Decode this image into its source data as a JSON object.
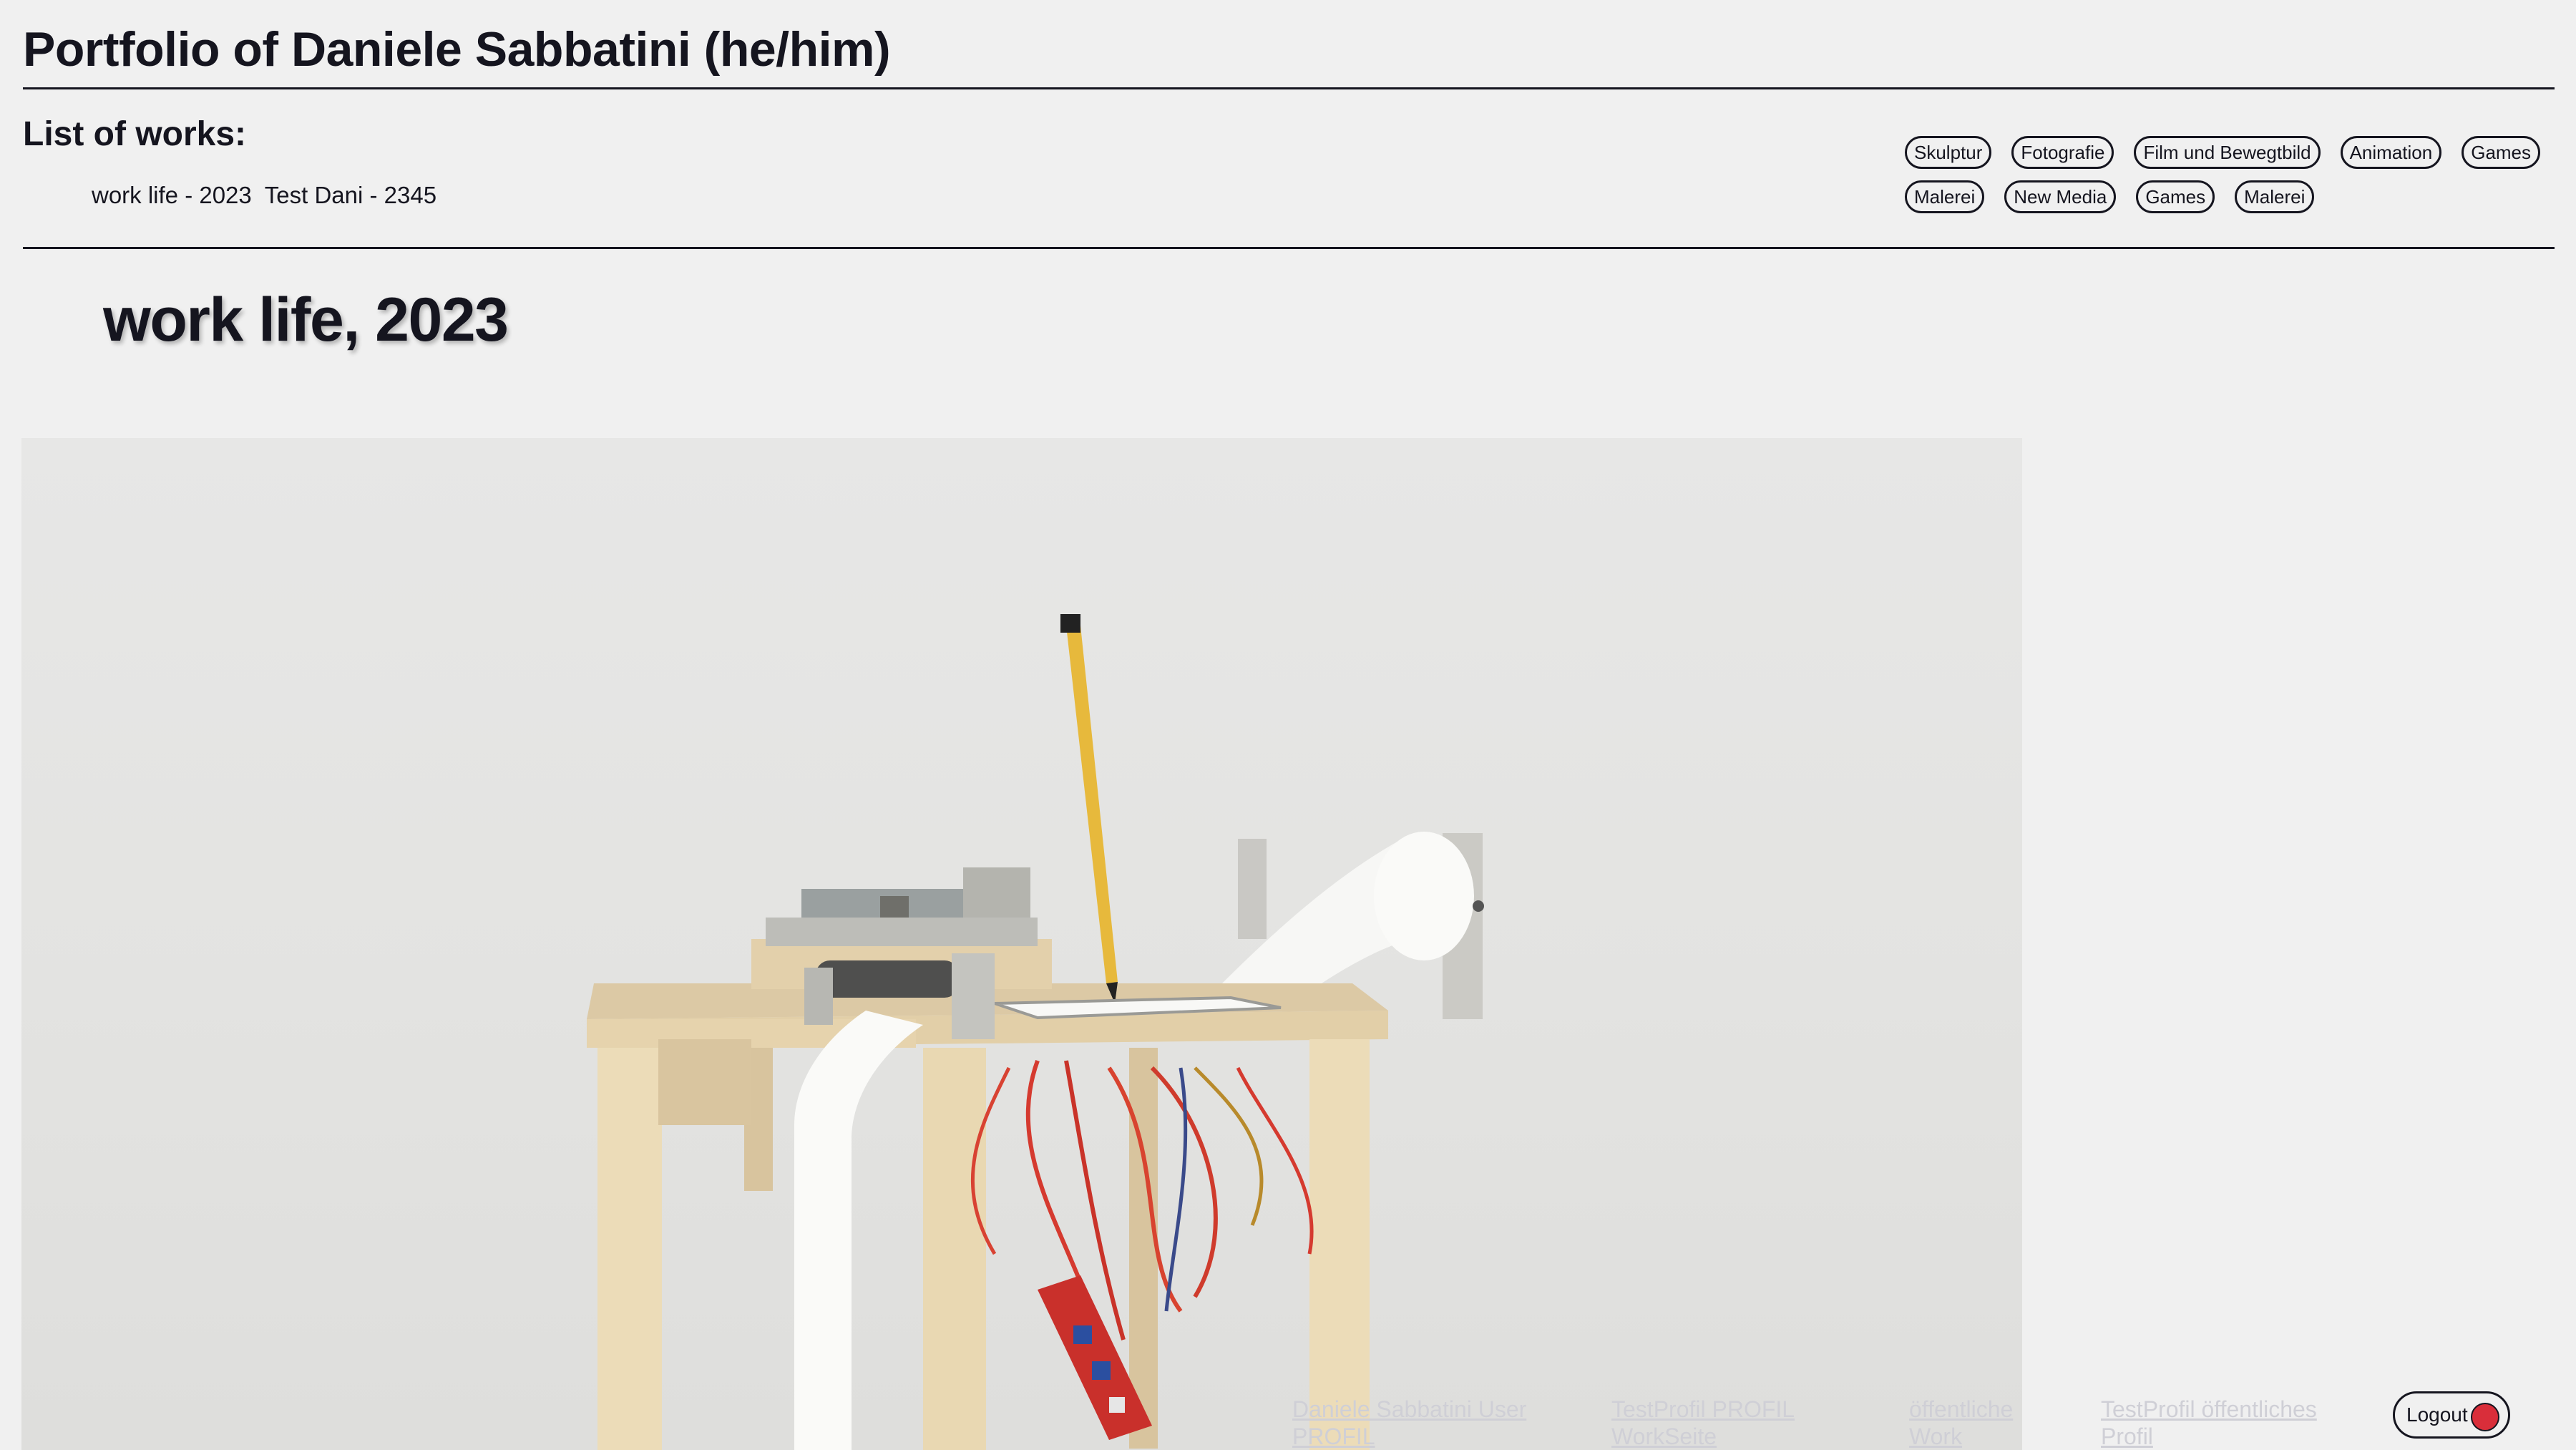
{
  "header": {
    "title": "Portfolio of Daniele Sabbatini (he/him)"
  },
  "works": {
    "heading": "List of works:",
    "items": [
      {
        "label": "work life - 2023"
      },
      {
        "label": "Test Dani - 2345"
      }
    ]
  },
  "tags": [
    "Skulptur",
    "Fotografie",
    "Film und Bewegtbild",
    "Animation",
    "Games",
    "Malerei",
    "New Media",
    "Games",
    "Malerei"
  ],
  "work": {
    "title": "work life, 2023",
    "image_icon": "plotter-installation-photo"
  },
  "footer": {
    "links": [
      "Daniele Sabbatini User PROFIL",
      "TestProfil PROFIL WorkSeite",
      "öffentliche Work",
      "TestProfil öffentliches Profil"
    ],
    "logout_label": "Logout",
    "logout_color": "#d92e3a"
  }
}
